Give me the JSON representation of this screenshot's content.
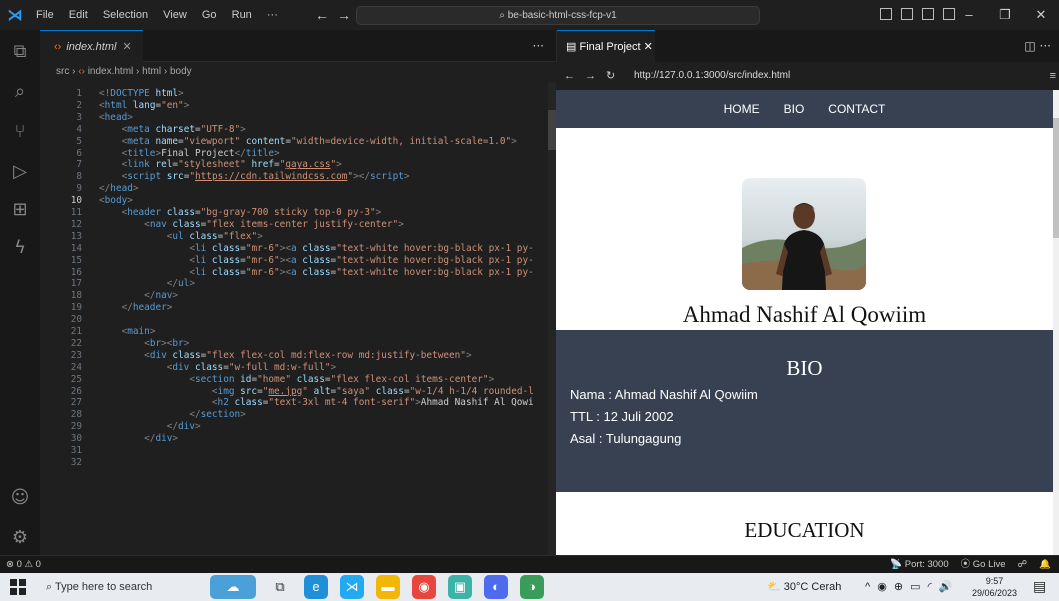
{
  "titlebar": {
    "menu": [
      "File",
      "Edit",
      "Selection",
      "View",
      "Go",
      "Run",
      "···"
    ],
    "command_center": "be-basic-html-css-fcp-v1"
  },
  "editor": {
    "tab_label": "index.html",
    "breadcrumb": [
      "src",
      "index.html",
      "html",
      "body"
    ],
    "lines": [
      {
        "n": "1",
        "html": "<span class=\"br\">&lt;!</span><span class=\"tg\">DOCTYPE</span> <span class=\"at\">html</span><span class=\"br\">&gt;</span>"
      },
      {
        "n": "2",
        "html": "<span class=\"br\">&lt;</span><span class=\"tg\">html</span> <span class=\"at\">lang</span>=<span class=\"st\">\"en\"</span><span class=\"br\">&gt;</span>"
      },
      {
        "n": "3",
        "html": "<span class=\"br\">&lt;</span><span class=\"tg\">head</span><span class=\"br\">&gt;</span>"
      },
      {
        "n": "4",
        "html": "    <span class=\"br\">&lt;</span><span class=\"tg\">meta</span> <span class=\"at\">charset</span>=<span class=\"st\">\"UTF-8\"</span><span class=\"br\">&gt;</span>"
      },
      {
        "n": "5",
        "html": "    <span class=\"br\">&lt;</span><span class=\"tg\">meta</span> <span class=\"at\">name</span>=<span class=\"st\">\"viewport\"</span> <span class=\"at\">content</span>=<span class=\"st\">\"width=device-width, initial-scale=1.0\"</span><span class=\"br\">&gt;</span>"
      },
      {
        "n": "6",
        "html": "    <span class=\"br\">&lt;</span><span class=\"tg\">title</span><span class=\"br\">&gt;</span>Final Project<span class=\"br\">&lt;/</span><span class=\"tg\">title</span><span class=\"br\">&gt;</span>"
      },
      {
        "n": "7",
        "html": "    <span class=\"br\">&lt;</span><span class=\"tg\">link</span> <span class=\"at\">rel</span>=<span class=\"st\">\"stylesheet\"</span> <span class=\"at\">href</span>=<span class=\"st\">\"<u>gaya.css</u>\"</span><span class=\"br\">&gt;</span>"
      },
      {
        "n": "8",
        "html": "    <span class=\"br\">&lt;</span><span class=\"tg\">script</span> <span class=\"at\">src</span>=<span class=\"st\">\"<u>https://cdn.tailwindcss.com</u>\"</span><span class=\"br\">&gt;&lt;/</span><span class=\"tg\">script</span><span class=\"br\">&gt;</span>"
      },
      {
        "n": "9",
        "html": "<span class=\"br\">&lt;/</span><span class=\"tg\">head</span><span class=\"br\">&gt;</span>"
      },
      {
        "n": "10",
        "html": "<span class=\"br\">&lt;</span><span class=\"tg\">body</span><span class=\"br\">&gt;</span>",
        "current": true
      },
      {
        "n": "11",
        "html": "    <span class=\"br\">&lt;</span><span class=\"tg\">header</span> <span class=\"at\">class</span>=<span class=\"st\">\"bg-gray-700 sticky top-0 py-3\"</span><span class=\"br\">&gt;</span>"
      },
      {
        "n": "12",
        "html": "        <span class=\"br\">&lt;</span><span class=\"tg\">nav</span> <span class=\"at\">class</span>=<span class=\"st\">\"flex items-center justify-center\"</span><span class=\"br\">&gt;</span>"
      },
      {
        "n": "13",
        "html": "            <span class=\"br\">&lt;</span><span class=\"tg\">ul</span> <span class=\"at\">class</span>=<span class=\"st\">\"flex\"</span><span class=\"br\">&gt;</span>"
      },
      {
        "n": "14",
        "html": "                <span class=\"br\">&lt;</span><span class=\"tg\">li</span> <span class=\"at\">class</span>=<span class=\"st\">\"mr-6\"</span><span class=\"br\">&gt;&lt;</span><span class=\"tg\">a</span> <span class=\"at\">class</span>=<span class=\"st\">\"text-white hover:bg-black px-1 py-</span>"
      },
      {
        "n": "15",
        "html": "                <span class=\"br\">&lt;</span><span class=\"tg\">li</span> <span class=\"at\">class</span>=<span class=\"st\">\"mr-6\"</span><span class=\"br\">&gt;&lt;</span><span class=\"tg\">a</span> <span class=\"at\">class</span>=<span class=\"st\">\"text-white hover:bg-black px-1 py-</span>"
      },
      {
        "n": "16",
        "html": "                <span class=\"br\">&lt;</span><span class=\"tg\">li</span> <span class=\"at\">class</span>=<span class=\"st\">\"mr-6\"</span><span class=\"br\">&gt;&lt;</span><span class=\"tg\">a</span> <span class=\"at\">class</span>=<span class=\"st\">\"text-white hover:bg-black px-1 py-</span>"
      },
      {
        "n": "17",
        "html": "            <span class=\"br\">&lt;/</span><span class=\"tg\">ul</span><span class=\"br\">&gt;</span>"
      },
      {
        "n": "18",
        "html": "        <span class=\"br\">&lt;/</span><span class=\"tg\">nav</span><span class=\"br\">&gt;</span>"
      },
      {
        "n": "19",
        "html": "    <span class=\"br\">&lt;/</span><span class=\"tg\">header</span><span class=\"br\">&gt;</span>"
      },
      {
        "n": "20",
        "html": ""
      },
      {
        "n": "21",
        "html": "    <span class=\"br\">&lt;</span><span class=\"tg\">main</span><span class=\"br\">&gt;</span>"
      },
      {
        "n": "22",
        "html": "        <span class=\"br\">&lt;</span><span class=\"tg\">br</span><span class=\"br\">&gt;&lt;</span><span class=\"tg\">br</span><span class=\"br\">&gt;</span>"
      },
      {
        "n": "23",
        "html": "        <span class=\"br\">&lt;</span><span class=\"tg\">div</span> <span class=\"at\">class</span>=<span class=\"st\">\"flex flex-col md:flex-row md:justify-between\"</span><span class=\"br\">&gt;</span>"
      },
      {
        "n": "24",
        "html": "            <span class=\"br\">&lt;</span><span class=\"tg\">div</span> <span class=\"at\">class</span>=<span class=\"st\">\"w-full md:w-full\"</span><span class=\"br\">&gt;</span>"
      },
      {
        "n": "25",
        "html": "                <span class=\"br\">&lt;</span><span class=\"tg\">section</span> <span class=\"at\">id</span>=<span class=\"st\">\"home\"</span> <span class=\"at\">class</span>=<span class=\"st\">\"flex flex-col items-center\"</span><span class=\"br\">&gt;</span>"
      },
      {
        "n": "26",
        "html": "                    <span class=\"br\">&lt;</span><span class=\"tg\">img</span> <span class=\"at\">src</span>=<span class=\"st\">\"<u>me.jpg</u>\"</span> <span class=\"at\">alt</span>=<span class=\"st\">\"saya\"</span> <span class=\"at\">class</span>=<span class=\"st\">\"w-1/4 h-1/4 rounded-l</span>"
      },
      {
        "n": "27",
        "html": "                    <span class=\"br\">&lt;</span><span class=\"tg\">h2</span> <span class=\"at\">class</span>=<span class=\"st\">\"text-3xl mt-4 font-serif\"</span><span class=\"br\">&gt;</span>Ahmad Nashif Al Qowi"
      },
      {
        "n": "28",
        "html": "                <span class=\"br\">&lt;/</span><span class=\"tg\">section</span><span class=\"br\">&gt;</span>"
      },
      {
        "n": "29",
        "html": "            <span class=\"br\">&lt;/</span><span class=\"tg\">div</span><span class=\"br\">&gt;</span>"
      },
      {
        "n": "30",
        "html": "        <span class=\"br\">&lt;/</span><span class=\"tg\">div</span><span class=\"br\">&gt;</span>"
      },
      {
        "n": "31",
        "html": ""
      },
      {
        "n": "32",
        "html": ""
      }
    ]
  },
  "preview": {
    "tab_label": "Final Project",
    "url": "http://127.0.0.1:3000/src/index.html",
    "nav_links": [
      "HOME",
      "BIO",
      "CONTACT"
    ],
    "name_heading": "Ahmad Nashif Al Qowiim",
    "bio_title": "BIO",
    "bio_lines": [
      "Nama : Ahmad Nashif Al Qowiim",
      "TTL : 12 Juli 2002",
      "Asal : Tulungagung"
    ],
    "education_title": "EDUCATION"
  },
  "statusbar": {
    "problems": "⊗ 0 ⚠ 0",
    "port": "Port: 3000",
    "golive": "Go Live"
  },
  "taskbar": {
    "search_placeholder": "Type here to search",
    "weather": "30°C  Cerah",
    "time": "9:57",
    "date": "29/06/2023"
  },
  "colors": {
    "accent": "#0078d4",
    "header_bg": "#374151",
    "editor_bg": "#1f1f1f"
  }
}
